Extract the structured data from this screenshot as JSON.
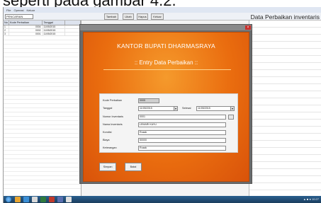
{
  "caption": "seperti pada gambar 4.2.",
  "app": {
    "menu": [
      "File",
      "Operasi",
      "Keluar"
    ],
    "search_value": "PENCARIAN",
    "toolbar_buttons": [
      "Tambah",
      "Ubah",
      "Hapus",
      "Keluar"
    ],
    "screen_title": "Data Perbaikan inventaris"
  },
  "grid": {
    "headers": [
      "No",
      "Kode Perbaikan",
      "Tanggal",
      ""
    ],
    "rows": [
      [
        "1",
        "0004",
        "11/05/2015",
        ""
      ],
      [
        "2",
        "0002",
        "11/05/2015",
        ""
      ],
      [
        "3",
        "0001",
        "11/05/2015",
        ""
      ]
    ]
  },
  "dialog": {
    "office_title": "KANTOR BUPATI DHARMASRAYA",
    "form_title": ":: Entry Data Perbaikan ::",
    "fields": {
      "kode_label": "Kode Perbaikan",
      "kode_value": "0005",
      "tanggal_label": "Tanggal",
      "tanggal_value": "11/05/2015",
      "selesai_label": "Selesai",
      "selesai_value": "11/05/2015",
      "nomor_label": "Nomor Inventaris",
      "nomor_value": "0001",
      "nama_label": "Nama Inventaris",
      "nama_value": "LEMARI KAYU",
      "kondisi_label": "Kondisi",
      "kondisi_value": "Rusak",
      "biaya_label": "Biaya",
      "biaya_value": "50000",
      "keterangan_label": "Keterangan",
      "keterangan_value": "Rusak"
    },
    "buttons": {
      "save": "Simpan",
      "cancel": "Batal"
    }
  },
  "taskbar": {
    "clock": "10:27"
  }
}
